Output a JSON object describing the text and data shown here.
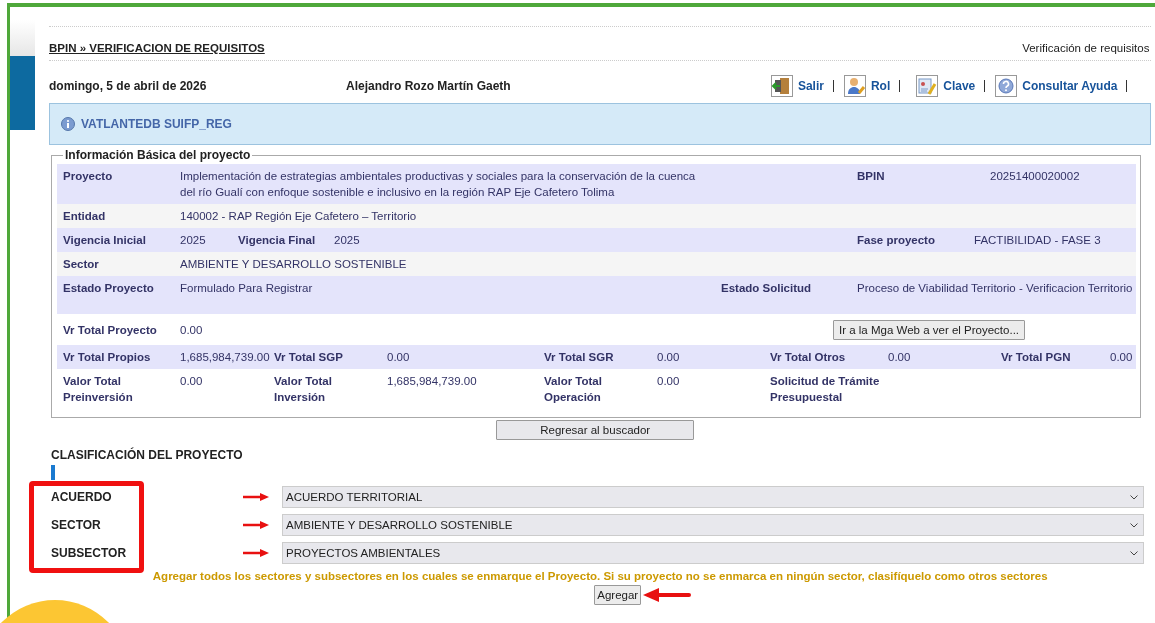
{
  "header": {
    "breadcrumb": "BPIN » VERIFICACION DE REQUISITOS",
    "page_title": "Verificación de requisitos"
  },
  "user_bar": {
    "date": "domingo, 5 de abril de 2026",
    "user": "Alejandro Rozo Martín Gaeth",
    "links": [
      {
        "label": "Salir"
      },
      {
        "label": "Rol"
      },
      {
        "label": "Clave"
      },
      {
        "label": "Consultar Ayuda"
      }
    ]
  },
  "banner": {
    "text": "VATLANTEDB SUIFP_REG"
  },
  "basic_info": {
    "legend": "Información Básica del proyecto",
    "lines": [
      {
        "kind": "project",
        "fields": [
          {
            "label": "Proyecto",
            "value": "Implementación de estrategias ambientales productivas y sociales para la conservación de la cuenca del río Gualí con enfoque sostenible e inclusivo en la región RAP Eje Cafetero Tolima"
          },
          {
            "label": "BPIN",
            "value": "20251400020002"
          }
        ]
      },
      {
        "kind": "single",
        "fields": [
          {
            "label": "Entidad",
            "value": "140002 - RAP Región Eje Cafetero – Territorio"
          }
        ]
      },
      {
        "kind": "vigencia",
        "fields": [
          {
            "label": "Vigencia Inicial",
            "value": "2025"
          },
          {
            "label": "Vigencia Final",
            "value": "2025"
          },
          {
            "label": "Fase proyecto",
            "value": "FACTIBILIDAD - FASE 3"
          }
        ]
      },
      {
        "kind": "single",
        "fields": [
          {
            "label": "Sector",
            "value": "AMBIENTE Y DESARROLLO SOSTENIBLE"
          }
        ]
      },
      {
        "kind": "estado",
        "fields": [
          {
            "label": "Estado Proyecto",
            "value": "Formulado Para Registrar"
          },
          {
            "label": "Estado Solicitud",
            "value": "Proceso de Viabilidad Territorio - Verificacion Territorio"
          }
        ]
      },
      {
        "kind": "total",
        "fields": [
          {
            "label": "Vr Total Proyecto",
            "value": "0.00"
          }
        ],
        "button": "Ir a la Mga Web a ver el Proyecto..."
      },
      {
        "kind": "amounts",
        "fields": [
          {
            "label": "Vr Total Propios",
            "value": "1,685,984,739.00"
          },
          {
            "label": "Vr Total SGP",
            "value": "0.00"
          },
          {
            "label": "Vr Total SGR",
            "value": "0.00"
          },
          {
            "label": "Vr Total Otros",
            "value": "0.00"
          },
          {
            "label": "Vr Total PGN",
            "value": "0.00"
          }
        ]
      },
      {
        "kind": "amounts",
        "fields": [
          {
            "label": "Valor Total Preinversión",
            "value": "0.00"
          },
          {
            "label": "Valor Total Inversión",
            "value": "1,685,984,739.00"
          },
          {
            "label": "Valor Total Operación",
            "value": "0.00"
          },
          {
            "label": "Solicitud de Trámite Presupuestal"
          }
        ]
      }
    ]
  },
  "back_button": {
    "label": "Regresar al buscador"
  },
  "classification": {
    "title": "CLASIFICACIÓN DEL PROYECTO",
    "fields": [
      {
        "label": "ACUERDO",
        "value": "ACUERDO TERRITORIAL"
      },
      {
        "label": "SECTOR",
        "value": "AMBIENTE Y DESARROLLO SOSTENIBLE"
      },
      {
        "label": "SUBSECTOR",
        "value": "PROYECTOS AMBIENTALES"
      }
    ],
    "note": "Agregar todos los sectores y subsectores en los cuales se enmarque el Proyecto. Si su proyecto no se enmarca en ningún sector, clasifíquelo como otros sectores",
    "add_button": {
      "label": "Agregar"
    }
  }
}
